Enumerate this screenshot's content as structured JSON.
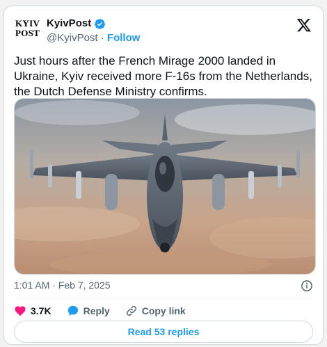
{
  "header": {
    "logo_line1": "KYIV",
    "logo_line2": "POST",
    "display_name": "KyivPost",
    "handle": "@KyivPost",
    "separator": "·",
    "follow_label": "Follow"
  },
  "tweet": {
    "text": "Just hours after the French Mirage 2000 landed in Ukraine, Kyiv received more F-16s from the Netherlands, the Dutch Defense Ministry confirms."
  },
  "meta": {
    "timestamp": "1:01 AM · Feb 7, 2025"
  },
  "actions": {
    "likes": "3.7K",
    "reply_label": "Reply",
    "copy_link_label": "Copy link"
  },
  "footer": {
    "read_replies_label": "Read 53 replies"
  },
  "colors": {
    "accent": "#1d9bf0",
    "like": "#f91880",
    "verified": "#1d9bf0"
  },
  "icons": [
    "verified-badge-icon",
    "x-logo-icon",
    "info-icon",
    "heart-icon",
    "reply-bubble-icon",
    "link-icon"
  ]
}
